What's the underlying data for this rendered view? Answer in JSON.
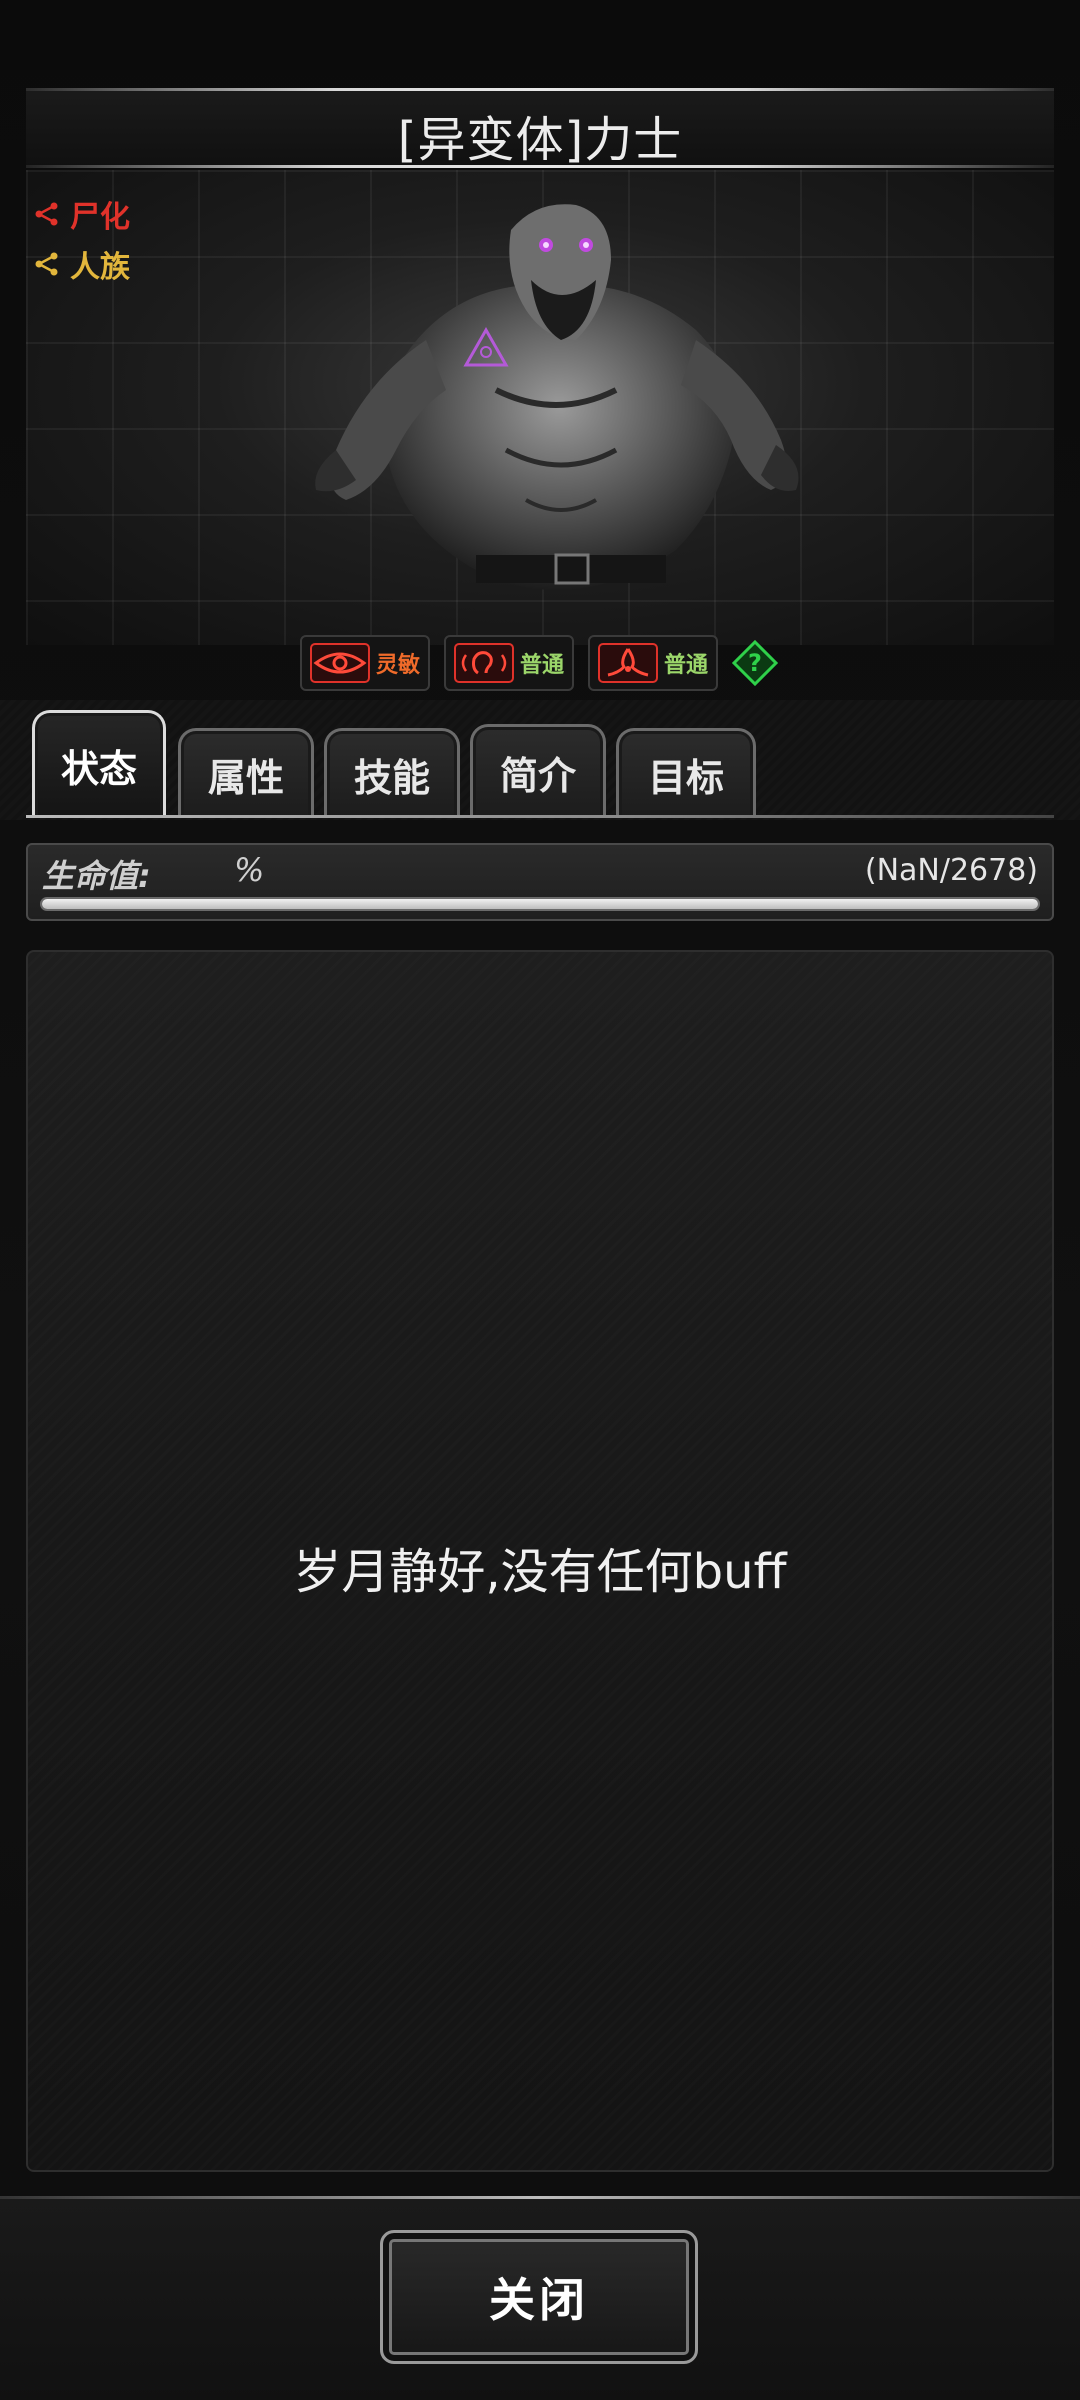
{
  "header": {
    "title": "[异变体]力士"
  },
  "portrait": {
    "tags": [
      {
        "label": "尸化",
        "color": "#e0322a"
      },
      {
        "label": "人族",
        "color": "#e2b63c"
      }
    ]
  },
  "traits": [
    {
      "label": "灵敏",
      "icon": "eye-icon"
    },
    {
      "label": "普通",
      "icon": "hearing-icon"
    },
    {
      "label": "普通",
      "icon": "scent-icon"
    }
  ],
  "help_icon": "question-icon",
  "tabs": [
    {
      "label": "状态",
      "active": true
    },
    {
      "label": "属性",
      "active": false
    },
    {
      "label": "技能",
      "active": false
    },
    {
      "label": "简介",
      "active": false
    },
    {
      "label": "目标",
      "active": false
    }
  ],
  "hp": {
    "label": "生命值:",
    "percent_text": "%",
    "value_text": "(NaN/2678)",
    "fill_fraction": 1.0
  },
  "status": {
    "empty_message": "岁月静好,没有任何buff"
  },
  "footer": {
    "close_label": "关闭"
  }
}
